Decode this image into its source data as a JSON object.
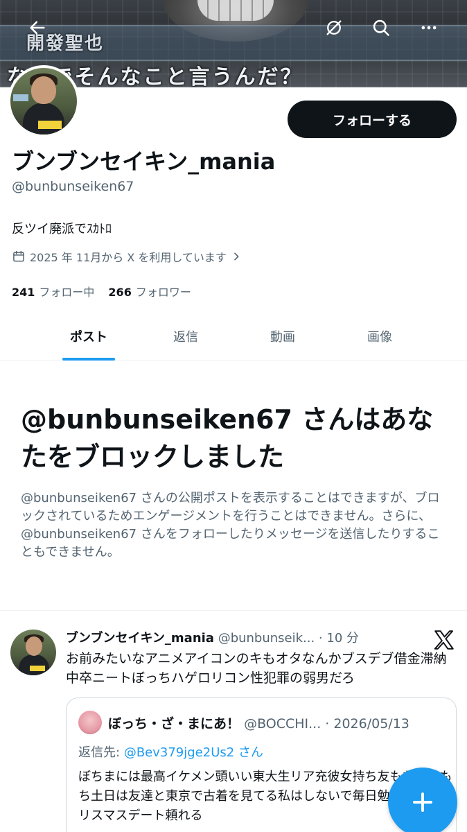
{
  "banner": {
    "caption_name": "開發聖也",
    "caption_line": "なんでそんなこと言うんだ？"
  },
  "top_bar": {
    "back_icon": "arrow-left-icon",
    "hide_icon": "eye-off-icon",
    "search_icon": "search-icon",
    "more_icon": "more-horizontal-icon"
  },
  "profile": {
    "display_name": "ブンブンセイキン_mania",
    "handle": "@bunbunseiken67",
    "bio": "反ツイ廃派でｽｶﾄﾛ",
    "joined": "2025 年 11月から X を利用しています",
    "following_count": "241",
    "following_label": "フォロー中",
    "followers_count": "266",
    "followers_label": "フォロワー",
    "follow_button": "フォローする"
  },
  "tabs": [
    {
      "label": "ポスト",
      "active": true
    },
    {
      "label": "返信",
      "active": false
    },
    {
      "label": "動画",
      "active": false
    },
    {
      "label": "画像",
      "active": false
    }
  ],
  "blocked": {
    "title": "@bunbunseiken67 さんはあなたをブロックしました",
    "body": "@bunbunseiken67 さんの公開ポストを表示することはできますが、ブロックされているためエンゲージメントを行うことはできません。さらに、@bunbunseiken67 さんをフォローしたりメッセージを送信したりすることもできません。"
  },
  "post": {
    "name": "ブンブンセイキン_mania",
    "meta": "@bunbunseik... · 10 分",
    "text": "お前みたいなアニメアイコンのキもオタなんかブスデブ借金滞納中卒ニートぼっちハゲロリコン性犯罪の弱男だろ",
    "quote": {
      "name": "ぼっち・ざ・まにあ！",
      "meta": "@BOCCHI... · 2026/05/13",
      "reply_prefix": "返信先:",
      "reply_to": "@Bev379jge2Us2 さん",
      "text": "ぼちまには最高イケメン頭いい東大生リア充彼女持ち友もち友達もち土日は友達と東京で古着を見てる私はしないで毎日勉強彼女とクリスマスデート頼れる"
    }
  },
  "colors": {
    "accent": "#1d9bf0",
    "text_primary": "#0f1419",
    "text_secondary": "#536471",
    "button_dark": "#0f1419"
  }
}
